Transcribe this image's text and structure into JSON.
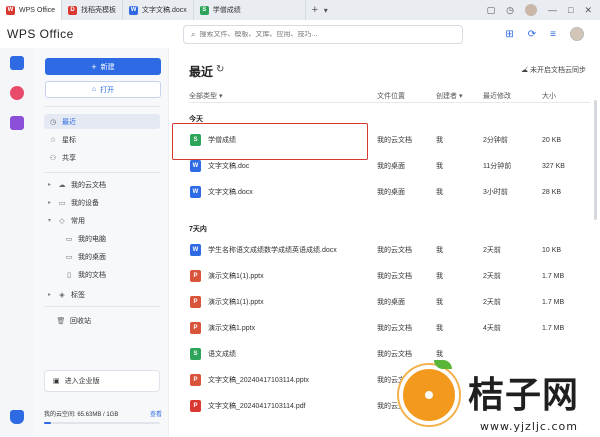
{
  "tabs": [
    {
      "label": "WPS Office",
      "color": "#d8382f"
    },
    {
      "label": "找稻壳模板",
      "color": "#d8382f"
    },
    {
      "label": "文字文稿.docx",
      "color": "#2d6ae3"
    },
    {
      "label": "学僧成绩",
      "color": "#2ea45a"
    }
  ],
  "header": {
    "logo": "WPS Office",
    "search_placeholder": "搜索文件、模板、文库、应用、技巧..."
  },
  "sidebar": {
    "new_label": "新建",
    "open_label": "打开",
    "items": [
      {
        "label": "最近",
        "icon": "clock-icon"
      },
      {
        "label": "星标",
        "icon": "star-icon"
      },
      {
        "label": "共享",
        "icon": "share-icon"
      },
      {
        "label": "我的云文档",
        "icon": "cloud-icon"
      },
      {
        "label": "我的设备",
        "icon": "device-icon"
      },
      {
        "label": "常用",
        "icon": "frequent-icon"
      },
      {
        "label": "我的电脑",
        "icon": "computer-icon"
      },
      {
        "label": "我的桌面",
        "icon": "desktop-icon"
      },
      {
        "label": "我的文档",
        "icon": "document-icon"
      },
      {
        "label": "标签",
        "icon": "tag-icon"
      },
      {
        "label": "回收站",
        "icon": "trash-icon"
      }
    ],
    "enterprise_label": "进入企业版",
    "storage_label": "我的云空间: 65.63MB / 1GB",
    "storage_view": "查看",
    "storage_fraction": 0.064
  },
  "main": {
    "title": "最近",
    "cloud_sync": "未开启文档云同步",
    "columns": {
      "type": "全部类型",
      "location": "文件位置",
      "creator": "创建者",
      "modified": "最近修改",
      "size": "大小"
    },
    "group_today": "今天",
    "group_week": "7天内",
    "rows_today": [
      {
        "name": "学僧成绩",
        "type": "S",
        "color": "#2ea45a",
        "location": "我的云文档",
        "creator": "我",
        "modified": "2分钟前",
        "size": "20 KB"
      },
      {
        "name": "文字文稿.doc",
        "type": "W",
        "color": "#2d6ae3",
        "location": "我的桌面",
        "creator": "我",
        "modified": "11分钟前",
        "size": "327 KB"
      },
      {
        "name": "文字文稿.docx",
        "type": "W",
        "color": "#2d6ae3",
        "location": "我的桌面",
        "creator": "我",
        "modified": "3小时前",
        "size": "28 KB"
      }
    ],
    "rows_week": [
      {
        "name": "学生名称语文成绩数学成绩英语成绩.docx",
        "type": "W",
        "color": "#2d6ae3",
        "location": "我的云文档",
        "creator": "我",
        "modified": "2天前",
        "size": "10 KB"
      },
      {
        "name": "演示文稿1(1).pptx",
        "type": "P",
        "color": "#d8543a",
        "location": "我的云文档",
        "creator": "我",
        "modified": "2天前",
        "size": "1.7 MB"
      },
      {
        "name": "演示文稿1(1).pptx",
        "type": "P",
        "color": "#d8543a",
        "location": "我的桌面",
        "creator": "我",
        "modified": "2天前",
        "size": "1.7 MB"
      },
      {
        "name": "演示文稿1.pptx",
        "type": "P",
        "color": "#d8543a",
        "location": "我的云文档",
        "creator": "我",
        "modified": "4天前",
        "size": "1.7 MB"
      },
      {
        "name": "语文成绩",
        "type": "S",
        "color": "#2ea45a",
        "location": "我的云文档",
        "creator": "我",
        "modified": "",
        "size": ""
      },
      {
        "name": "文字文稿_20240417103114.pptx",
        "type": "P",
        "color": "#d8543a",
        "location": "我的云文档",
        "creator": "",
        "modified": "",
        "size": ""
      },
      {
        "name": "文字文稿_20240417103114.pdf",
        "type": "P",
        "color": "#d8382f",
        "location": "我的云文档",
        "creator": "",
        "modified": "",
        "size": ""
      }
    ]
  },
  "watermark": {
    "brand": "桔子网",
    "url": "www.yjzljc.com"
  }
}
